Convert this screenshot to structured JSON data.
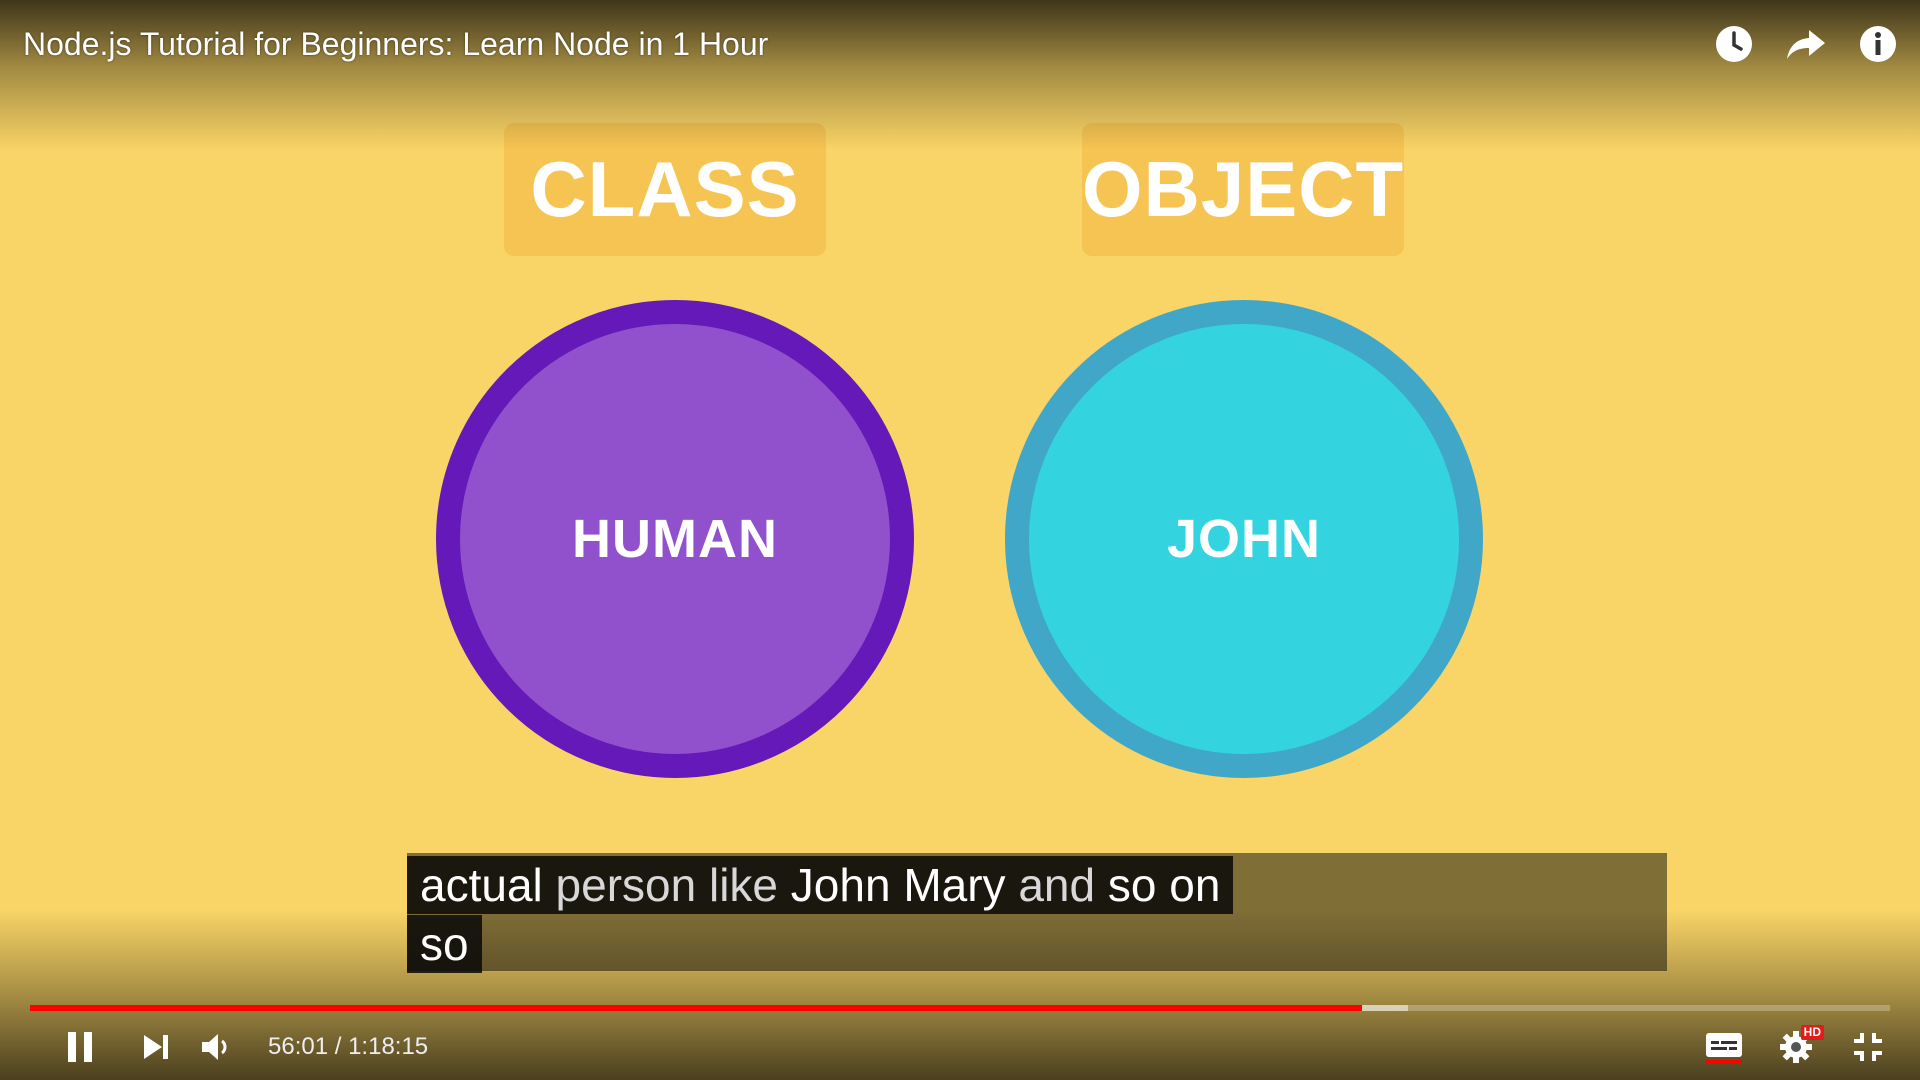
{
  "video": {
    "title": "Node.js Tutorial for Beginners: Learn Node in 1 Hour"
  },
  "top_icons": [
    {
      "name": "watch-later-icon"
    },
    {
      "name": "share-icon"
    },
    {
      "name": "info-icon"
    }
  ],
  "slide": {
    "class_label": "CLASS",
    "object_label": "OBJECT",
    "class_circle_text": "HUMAN",
    "object_circle_text": "JOHN",
    "colors": {
      "background": "#f9d466",
      "label_box": "#f6c453",
      "human_fill": "#9150cc",
      "human_ring": "#6419b8",
      "john_fill": "#33d4e0",
      "john_ring": "#40a7c9"
    }
  },
  "captions": {
    "line1_words": [
      "actual",
      "person",
      "like",
      "John",
      "Mary",
      "and",
      "so",
      "on"
    ],
    "line2": "so"
  },
  "playback": {
    "current_time": "56:01",
    "separator": "/",
    "duration": "1:18:15",
    "progress_fraction": 0.716,
    "buffered_fraction": 0.741,
    "hd_badge": "HD",
    "colors": {
      "played": "#ff0000"
    }
  }
}
